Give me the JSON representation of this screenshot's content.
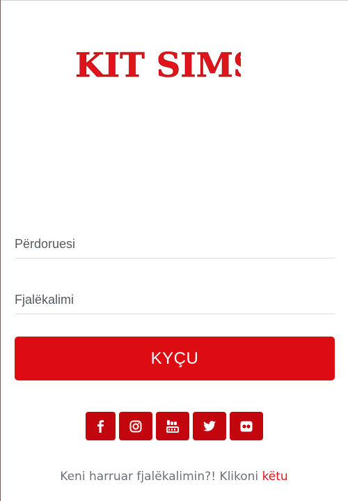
{
  "brand": {
    "logo_text": "KIT SIMS",
    "color": "#e0141b"
  },
  "form": {
    "username_placeholder": "Përdoruesi",
    "password_placeholder": "Fjalëkalimi",
    "submit_label": "KYÇU",
    "button_color": "#dd0c13"
  },
  "social": {
    "color": "#c3050d",
    "icons": [
      "facebook-icon",
      "instagram-icon",
      "youtube-icon",
      "twitter-icon",
      "flickr-icon"
    ]
  },
  "forgot": {
    "text": "Keni harruar fjalëkalimin?! Klikoni ",
    "link_label": "këtu",
    "link_color": "#e1121a"
  }
}
